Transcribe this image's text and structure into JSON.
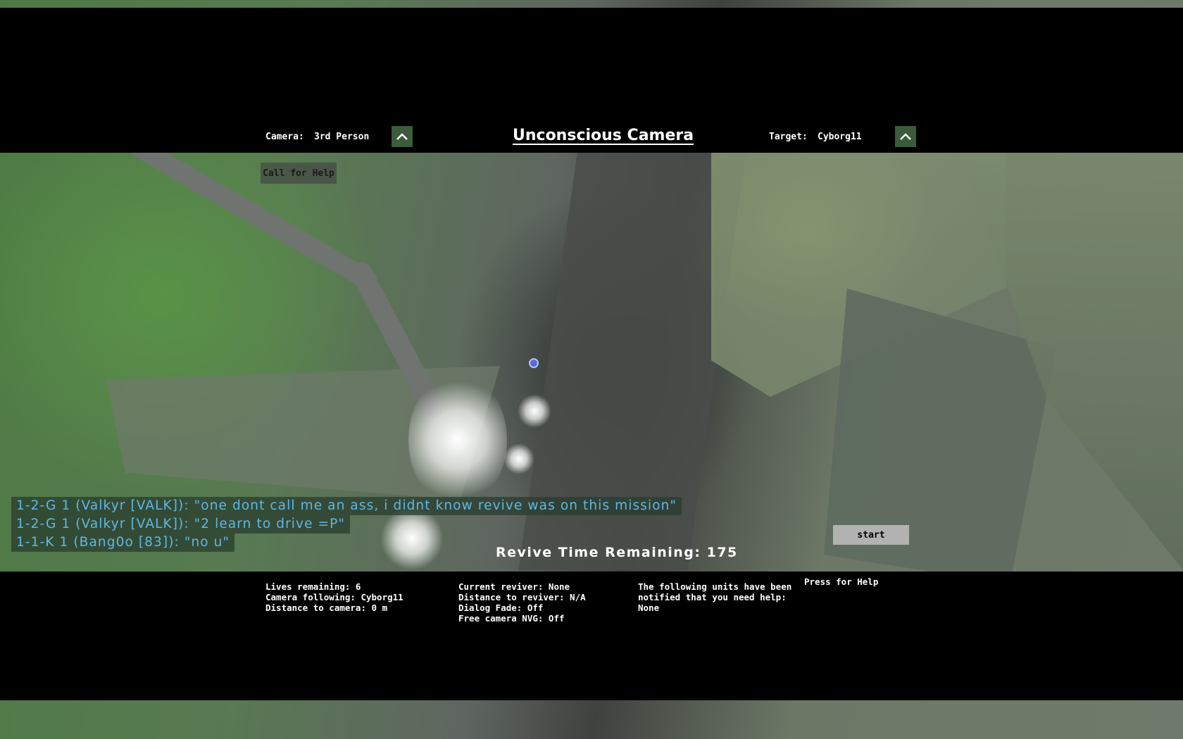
{
  "dialog": {
    "title": "Unconscious Camera",
    "camera_label": "Camera:",
    "camera_value": "3rd Person",
    "target_label": "Target:",
    "target_value": "Cyborg11",
    "call_for_help_label": "Call for Help",
    "start_label": "start",
    "revive_time": "Revive Time Remaining: 175",
    "press_for_help": "Press for Help"
  },
  "chat": [
    "1-2-G 1 (Valkyr [VALK]): \"one dont call me an ass, i didnt know revive was on this mission\"",
    "1-2-G 1 (Valkyr [VALK]): \"2 learn to drive =P\"",
    "1-1-K 1 (Bang0o [83]): \"no u\""
  ],
  "info": {
    "col1": [
      "Lives remaining: 6",
      "Camera following: Cyborg11",
      "Distance to camera: 0 m"
    ],
    "col2": [
      "Current reviver: None",
      "Distance to reviver: N/A",
      "Dialog Fade: Off",
      "Free camera NVG: Off"
    ],
    "col3": [
      "The following units have been",
      "notified that you need help:",
      "None"
    ]
  },
  "colors": {
    "chat_text": "#5fb8e4",
    "button_green": "#3c5a3c",
    "start_button": "#b2b2b2"
  },
  "icons": {
    "camera_toggle": "chevron-up-icon",
    "target_toggle": "chevron-up-icon",
    "reviver_marker": "marker-dot-icon"
  }
}
